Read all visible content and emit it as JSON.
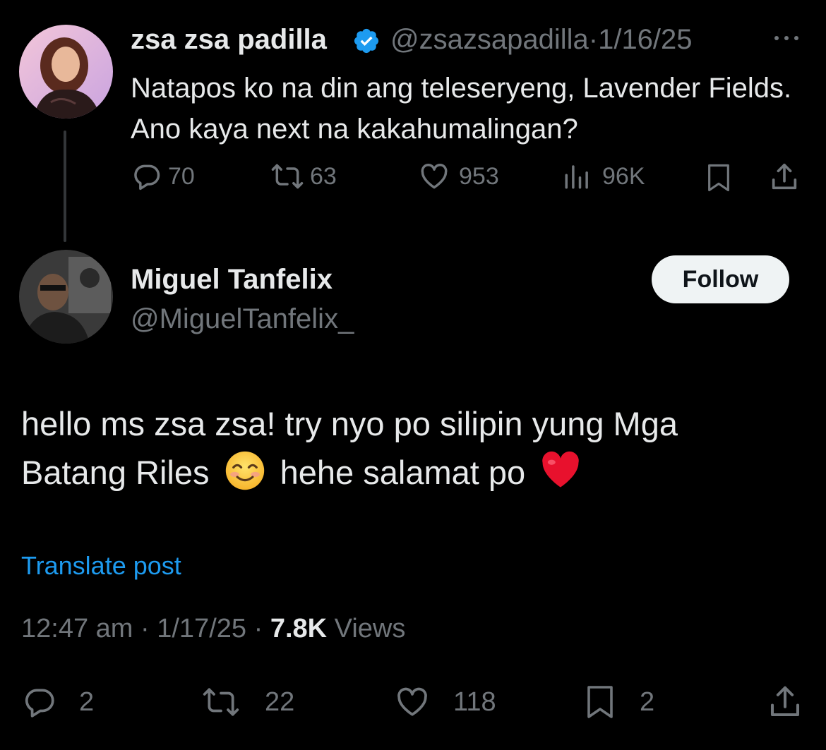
{
  "original_tweet": {
    "author_name": "zsa zsa padilla",
    "handle": "@zsazsapadilla",
    "separator": "·",
    "date": "1/16/25",
    "more_icon": "ellipsis-icon",
    "text": "Natapos ko na din ang teleseryeng, Lavender Fields. Ano kaya next na kakahumalingan?",
    "stats": {
      "replies": "70",
      "reposts": "63",
      "likes": "953",
      "views": "96K"
    }
  },
  "reply": {
    "author_name": "Miguel Tanfelix",
    "handle": "@MiguelTanfelix_",
    "follow_label": "Follow",
    "text_line1": "hello ms zsa zsa! try nyo po silipin yung Mga",
    "text_line2_a": "Batang Riles",
    "text_line2_b": "hehe salamat po",
    "translate_label": "Translate post",
    "time": "12:47 am",
    "sep1": "·",
    "date": "1/17/25",
    "sep2": "·",
    "views_count": "7.8K",
    "views_label": "Views",
    "stats": {
      "replies": "2",
      "reposts": "22",
      "likes": "118",
      "bookmarks": "2"
    }
  },
  "colors": {
    "background": "#000000",
    "text": "#e7e9ea",
    "muted": "#71767b",
    "link": "#1d9bf0",
    "verified": "#1d9bf0"
  }
}
